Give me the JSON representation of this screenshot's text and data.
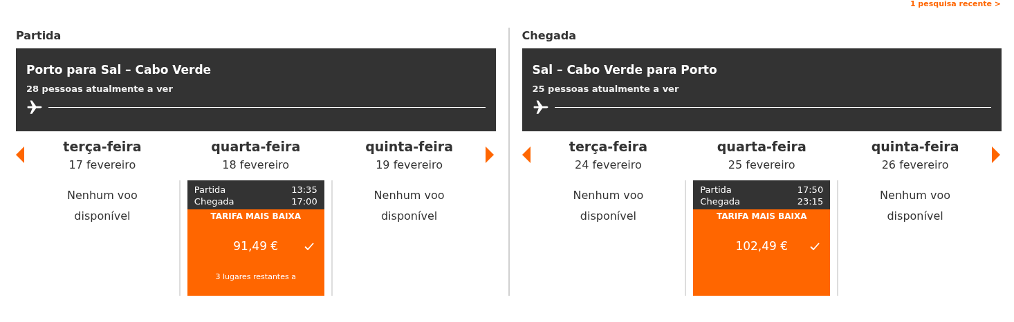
{
  "recent_searches_link": "1 pesquisa recente >",
  "legs": [
    {
      "heading": "Partida",
      "route": "Porto para Sal – Cabo Verde",
      "viewers": "28 pessoas atualmente a ver",
      "days": [
        {
          "weekday": "terça-feira",
          "date": "17 fevereiro",
          "no_flight": "Nenhum voo disponível"
        },
        {
          "weekday": "quarta-feira",
          "date": "18 fevereiro",
          "flight": {
            "departure_label": "Partida",
            "departure_time": "13:35",
            "arrival_label": "Chegada",
            "arrival_time": "17:00",
            "badge": "TARIFA MAIS BAIXA",
            "price": "91,49 €",
            "selected": true,
            "seats_note": "3 lugares restantes a"
          }
        },
        {
          "weekday": "quinta-feira",
          "date": "19 fevereiro",
          "no_flight": "Nenhum voo disponível"
        }
      ]
    },
    {
      "heading": "Chegada",
      "route": "Sal – Cabo Verde para Porto",
      "viewers": "25 pessoas atualmente a ver",
      "days": [
        {
          "weekday": "terça-feira",
          "date": "24 fevereiro",
          "no_flight": "Nenhum voo disponível"
        },
        {
          "weekday": "quarta-feira",
          "date": "25 fevereiro",
          "flight": {
            "departure_label": "Partida",
            "departure_time": "17:50",
            "arrival_label": "Chegada",
            "arrival_time": "23:15",
            "badge": "TARIFA MAIS BAIXA",
            "price": "102,49 €",
            "selected": true
          }
        },
        {
          "weekday": "quinta-feira",
          "date": "26 fevereiro",
          "no_flight": "Nenhum voo disponível"
        }
      ]
    }
  ]
}
